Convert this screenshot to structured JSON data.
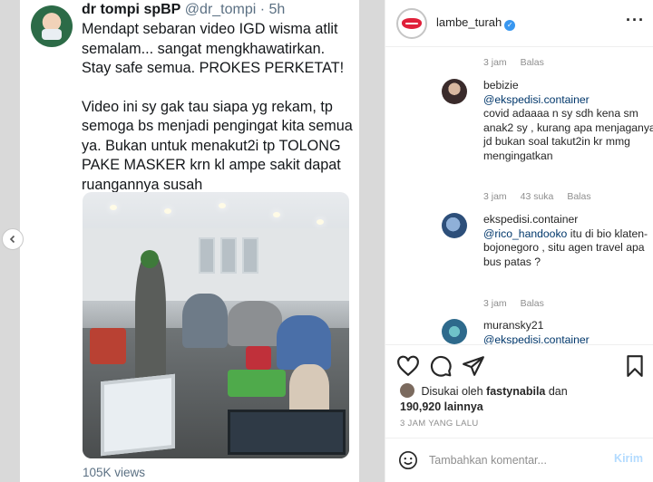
{
  "tweet": {
    "name": "dr tompi spBP",
    "handle": "@dr_tompi",
    "time": "· 5h",
    "paragraph1": "Mendapt sebaran video IGD wisma atlit semalam... sangat mengkhawatirkan. Stay safe semua. PROKES PERKETAT!",
    "paragraph2": "Video ini sy gak tau siapa yg rekam, tp semoga bs menjadi pengingat kita semua ya. Bukan untuk menakut2i tp TOLONG PAKE MASKER krn kl ampe sakit dapat ruangannya susah",
    "views": "105K views"
  },
  "carousel": {
    "prev_icon": "chevron-left-icon"
  },
  "post": {
    "username": "lambe_turah",
    "verified_icon": "verified-badge-icon",
    "more_icon": "more-options-icon"
  },
  "comments": {
    "first_meta": {
      "time": "3 jam",
      "reply": "Balas"
    },
    "items": [
      {
        "user": "bebizie",
        "mention": "@ekspedisi.container",
        "text": "covid adaaaa n sy sdh kena sm anak2 sy , kurang apa menjaganya. jd bukan soal takut2in kr mmg mengingatkan",
        "time": "3 jam",
        "likes": "43 suka",
        "reply": "Balas"
      },
      {
        "user": "ekspedisi.container",
        "mention": "@rico_handooko",
        "text": "itu di bio klaten-bojonegoro , situ agen travel apa bus patas ?",
        "time": "3 jam",
        "likes": "",
        "reply": "Balas"
      },
      {
        "user": "muransky21",
        "mention": "@ekspedisi.container",
        "text": "",
        "time": "",
        "likes": "",
        "reply": ""
      }
    ]
  },
  "likes": {
    "prefix": "Disukai oleh",
    "user": "fastynabila",
    "connector": "dan",
    "count": "190,920 lainnya"
  },
  "post_time": "3 JAM YANG LALU",
  "comment_box": {
    "placeholder": "Tambahkan komentar...",
    "post_label": "Kirim"
  },
  "colors": {
    "link": "#00376b",
    "verified": "#3897f0",
    "brand_lips": "#e0203a",
    "post_button_disabled": "#b3dbff"
  }
}
